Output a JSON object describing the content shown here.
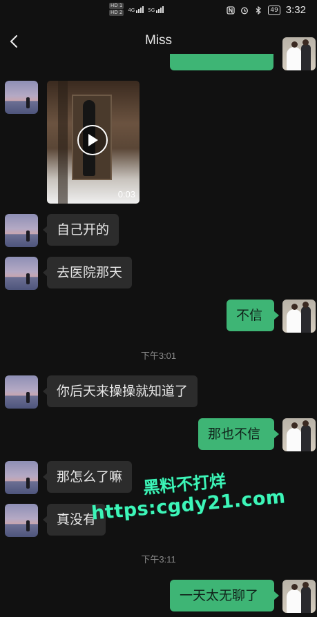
{
  "status_bar": {
    "hd_badge_1": "HD 1",
    "hd_badge_2": "HD 2",
    "network_1": "4G",
    "network_2": "5G",
    "battery": "49",
    "time": "3:32"
  },
  "header": {
    "title": "Miss"
  },
  "messages": [
    {
      "from": "contact",
      "type": "video",
      "duration": "0:03"
    },
    {
      "from": "contact",
      "type": "text",
      "text": "自己开的"
    },
    {
      "from": "contact",
      "type": "text",
      "text": "去医院那天"
    },
    {
      "from": "me",
      "type": "text",
      "text": "不信"
    },
    {
      "type": "timestamp",
      "text": "下午3:01"
    },
    {
      "from": "contact",
      "type": "text",
      "text": "你后天来操操就知道了"
    },
    {
      "from": "me",
      "type": "text",
      "text": "那也不信"
    },
    {
      "from": "contact",
      "type": "text",
      "text": "那怎么了嘛"
    },
    {
      "from": "contact",
      "type": "text",
      "text": "真没有"
    },
    {
      "type": "timestamp",
      "text": "下午3:11"
    },
    {
      "from": "me",
      "type": "text",
      "text": "一天太无聊了"
    }
  ],
  "watermark": {
    "line1": "黑料不打烊",
    "line2": "https:cgdy21.com"
  },
  "colors": {
    "background": "#111111",
    "incoming_bubble": "#2c2c2c",
    "outgoing_bubble": "#3eb575",
    "watermark": "#3df5b8"
  },
  "icons": [
    "back-arrow-icon",
    "more-dots-icon",
    "play-icon",
    "wifi-icon",
    "bluetooth-icon",
    "alarm-icon",
    "nfc-icon",
    "battery-icon"
  ]
}
